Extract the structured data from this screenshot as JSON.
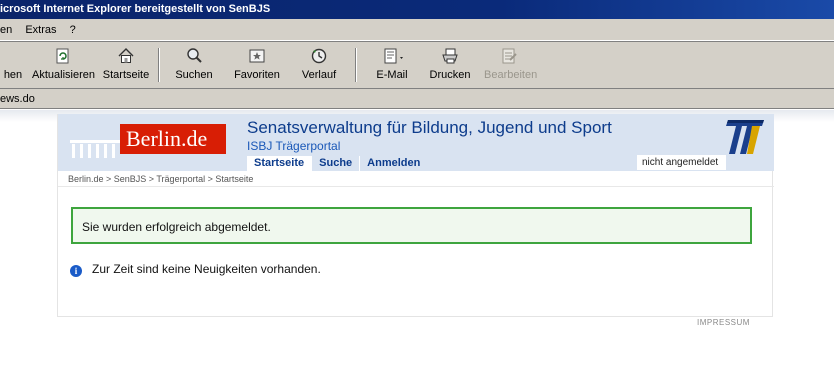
{
  "window": {
    "title": "icrosoft Internet Explorer bereitgestellt von SenBJS"
  },
  "menu": {
    "items": [
      "en",
      "Extras",
      "?"
    ]
  },
  "toolbar": {
    "buttons": [
      {
        "label": "hen",
        "icon": "back-icon",
        "enabled": true
      },
      {
        "label": "Aktualisieren",
        "icon": "refresh-icon",
        "enabled": true
      },
      {
        "label": "Startseite",
        "icon": "home-icon",
        "enabled": true
      },
      {
        "label": "Suchen",
        "icon": "search-icon",
        "enabled": true
      },
      {
        "label": "Favoriten",
        "icon": "favorites-icon",
        "enabled": true
      },
      {
        "label": "Verlauf",
        "icon": "history-icon",
        "enabled": true
      },
      {
        "label": "E-Mail",
        "icon": "mail-icon",
        "enabled": true
      },
      {
        "label": "Drucken",
        "icon": "print-icon",
        "enabled": true
      },
      {
        "label": "Bearbeiten",
        "icon": "edit-icon",
        "enabled": false
      }
    ]
  },
  "address": {
    "value": "ews.do"
  },
  "site": {
    "logo_text": "Berlin.de",
    "title": "Senatsverwaltung für Bildung, Jugend und Sport",
    "subtitle": "ISBJ Trägerportal",
    "nav": [
      {
        "label": "Startseite",
        "active": true
      },
      {
        "label": "Suche",
        "active": false
      },
      {
        "label": "Anmelden",
        "active": false
      }
    ],
    "login_status": "nicht angemeldet",
    "breadcrumb": "Berlin.de > SenBJS > Trägerportal > Startseite"
  },
  "content": {
    "success_message": "Sie wurden erfolgreich abgemeldet.",
    "info_message": "Zur Zeit sind keine Neuigkeiten vorhanden.",
    "info_icon_glyph": "i"
  },
  "footer": {
    "impressum": "IMPRESSUM"
  },
  "colors": {
    "title_bar": "#0a246a",
    "header_bg": "#d9e3f1",
    "berlin_red": "#d81e05",
    "title_blue": "#0d3c8c",
    "success_border": "#3ea53e"
  }
}
